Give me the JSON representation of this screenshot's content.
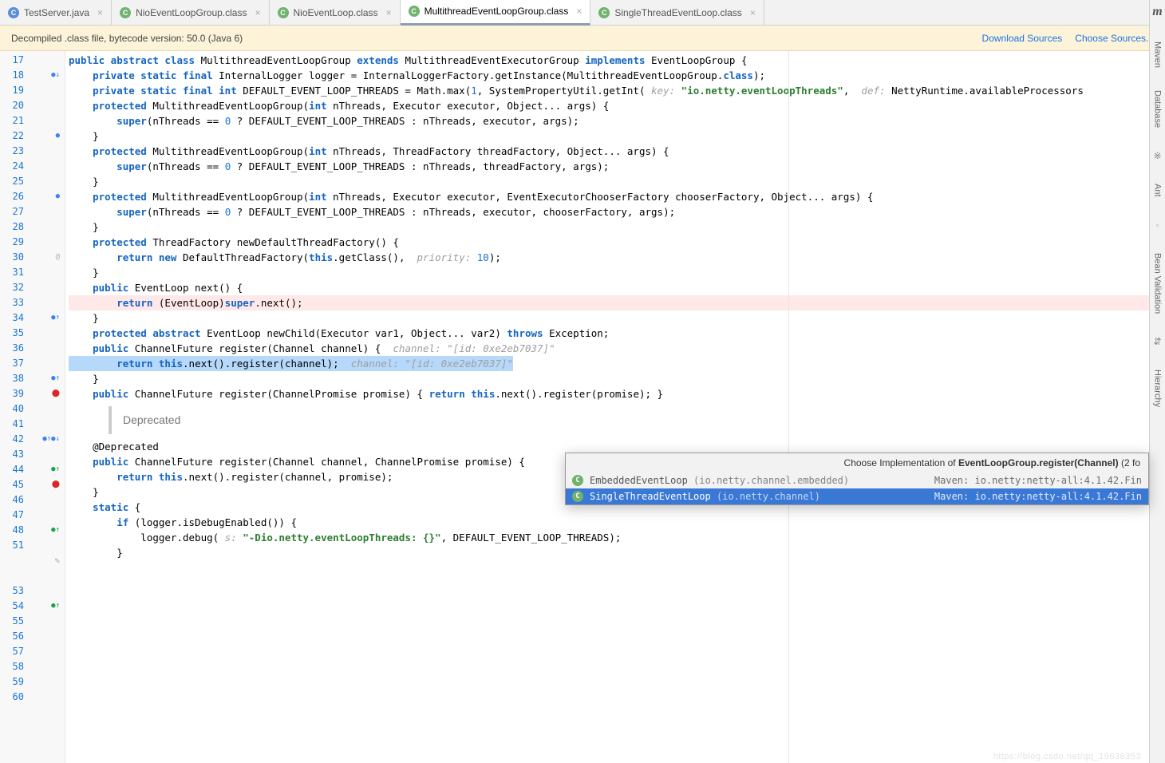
{
  "tabs": [
    {
      "name": "TestServer.java",
      "kind": "java"
    },
    {
      "name": "NioEventLoopGroup.class",
      "kind": "class"
    },
    {
      "name": "NioEventLoop.class",
      "kind": "class"
    },
    {
      "name": "MultithreadEventLoopGroup.class",
      "kind": "class",
      "active": true
    },
    {
      "name": "SingleThreadEventLoop.class",
      "kind": "class"
    }
  ],
  "banner": {
    "message": "Decompiled .class file, bytecode version: 50.0 (Java 6)",
    "link1": "Download Sources",
    "link2": "Choose Sources..."
  },
  "gutter_start": 17,
  "gutter_lines": [
    {
      "n": 17
    },
    {
      "n": 18,
      "marks": [
        "●↓"
      ],
      "cls": "m-blue"
    },
    {
      "n": 19
    },
    {
      "n": 20
    },
    {
      "n": 21
    },
    {
      "n": 22,
      "marks": [
        "●"
      ],
      "cls": "m-blue"
    },
    {
      "n": 23
    },
    {
      "n": 24
    },
    {
      "n": 25
    },
    {
      "n": 26,
      "marks": [
        "●"
      ],
      "cls": "m-blue"
    },
    {
      "n": 27
    },
    {
      "n": 28
    },
    {
      "n": 29
    },
    {
      "n": 30,
      "marks": [
        "@"
      ],
      "cls": ""
    },
    {
      "n": 31
    },
    {
      "n": 32
    },
    {
      "n": 33
    },
    {
      "n": 34,
      "marks": [
        "●↑"
      ],
      "cls": "m-blue"
    },
    {
      "n": 35
    },
    {
      "n": 36
    },
    {
      "n": 37
    },
    {
      "n": 38,
      "marks": [
        "●↑"
      ],
      "cls": "m-blue"
    },
    {
      "n": 39,
      "marks": [
        "⬤"
      ],
      "cls": "m-red"
    },
    {
      "n": 40
    },
    {
      "n": 41
    },
    {
      "n": 42,
      "marks": [
        "●↑",
        "●↓"
      ],
      "cls": "m-blue"
    },
    {
      "n": 43
    },
    {
      "n": 44,
      "marks": [
        "●↑"
      ],
      "cls": "m-green"
    },
    {
      "n": 45,
      "marks": [
        "⬤"
      ],
      "cls": "m-red"
    },
    {
      "n": 46
    },
    {
      "n": 47
    },
    {
      "n": 48,
      "marks": [
        "●↑"
      ],
      "cls": "m-green"
    },
    {
      "n": 51
    },
    {
      "n": "",
      "pencil": true
    },
    {
      "n": ""
    },
    {
      "n": 53
    },
    {
      "n": 54,
      "marks": [
        "●↑"
      ],
      "cls": "m-green"
    },
    {
      "n": 55
    },
    {
      "n": 56
    },
    {
      "n": 57
    },
    {
      "n": 58
    },
    {
      "n": 59
    },
    {
      "n": 60
    }
  ],
  "code": {
    "l18_a": "public abstract class",
    "l18_b": " MultithreadEventLoopGroup ",
    "l18_c": "extends",
    "l18_d": " MultithreadEventExecutorGroup ",
    "l18_e": "implements",
    "l18_f": " EventLoopGroup {",
    "l19_a": "    private static final",
    "l19_b": " InternalLogger logger = InternalLoggerFactory.getInstance(MultithreadEventLoopGroup.",
    "l19_c": "class",
    "l19_d": ");",
    "l20_a": "    private static final int",
    "l20_b": " DEFAULT_EVENT_LOOP_THREADS = Math.max(",
    "l20_c": "1",
    "l20_d": ", SystemPropertyUtil.getInt( ",
    "l20_key": "key: ",
    "l20_str": "\"io.netty.eventLoopThreads\"",
    "l20_e": ",  ",
    "l20_def": "def: ",
    "l20_f": "NettyRuntime.availableProcessors",
    "l22_a": "    protected",
    "l22_b": " MultithreadEventLoopGroup(",
    "l22_c": "int",
    "l22_d": " nThreads, Executor executor, Object... args) {",
    "l23_a": "        super",
    "l23_b": "(nThreads == ",
    "l23_c": "0",
    "l23_d": " ? DEFAULT_EVENT_LOOP_THREADS : nThreads, executor, args);",
    "l24": "    }",
    "l26_a": "    protected",
    "l26_b": " MultithreadEventLoopGroup(",
    "l26_c": "int",
    "l26_d": " nThreads, ThreadFactory threadFactory, Object... args) {",
    "l27_a": "        super",
    "l27_b": "(nThreads == ",
    "l27_c": "0",
    "l27_d": " ? DEFAULT_EVENT_LOOP_THREADS : nThreads, threadFactory, args);",
    "l28": "    }",
    "l30_a": "    protected",
    "l30_b": " MultithreadEventLoopGroup(",
    "l30_c": "int",
    "l30_d": " nThreads, Executor executor, EventExecutorChooserFactory chooserFactory, Object... args) {",
    "l31_a": "        super",
    "l31_b": "(nThreads == ",
    "l31_c": "0",
    "l31_d": " ? DEFAULT_EVENT_LOOP_THREADS : nThreads, executor, chooserFactory, args);",
    "l32": "    }",
    "l34_a": "    protected",
    "l34_b": " ThreadFactory newDefaultThreadFactory() {",
    "l35_a": "        return new",
    "l35_b": " DefaultThreadFactory(",
    "l35_c": "this",
    "l35_d": ".getClass(),  ",
    "l35_pri": "priority: ",
    "l35_e": "10",
    "l35_f": ");",
    "l36": "    }",
    "l38_a": "    public",
    "l38_b": " EventLoop next() {",
    "l39_a": "        return",
    "l39_b": " (EventLoop)",
    "l39_c": "super",
    "l39_d": ".next();",
    "l40": "    }",
    "l42_a": "    protected abstract",
    "l42_b": " EventLoop newChild(Executor var1, Object... var2) ",
    "l42_c": "throws",
    "l42_d": " Exception;",
    "l44_a": "    public",
    "l44_b": " ChannelFuture register(Channel channel) {  ",
    "l44_c": "channel: \"[id: 0xe2eb7037]\"",
    "l45_a": "        return this",
    "l45_b": ".next().register(channel);  ",
    "l45_c": "channel: \"[id: 0xe2eb7037]\"",
    "l46": "    }",
    "l48_a": "    public",
    "l48_b": " ChannelFuture register(ChannelPromise promise) { ",
    "l48_c": "return this",
    "l48_d": ".next().register(promise); }",
    "dep": "Deprecated",
    "l53": "    @Deprecated",
    "l54_a": "    public",
    "l54_b": " ChannelFuture register(Channel channel, ChannelPromise promise) {",
    "l55_a": "        return this",
    "l55_b": ".next().register(channel, promise);",
    "l56": "    }",
    "l58_a": "    static",
    "l58_b": " {",
    "l59_a": "        if",
    "l59_b": " (logger.isDebugEnabled()) {",
    "l60_a": "            logger.debug( ",
    "l60_s": "s: ",
    "l60_str": "\"-Dio.netty.eventLoopThreads: {}\"",
    "l60_b": ", DEFAULT_EVENT_LOOP_THREADS);",
    "l61": "        }"
  },
  "popup": {
    "title_a": "Choose Implementation of ",
    "title_b": "EventLoopGroup.register(Channel)",
    "title_c": " (2 fo",
    "rows": [
      {
        "name": "EmbeddedEventLoop",
        "pkg": "(io.netty.channel.embedded)",
        "loc": "Maven: io.netty:netty-all:4.1.42.Fin"
      },
      {
        "name": "SingleThreadEventLoop",
        "pkg": "(io.netty.channel)",
        "loc": "Maven: io.netty:netty-all:4.1.42.Fin",
        "sel": true
      }
    ]
  },
  "side": [
    "Maven",
    "Database",
    "Ant",
    "Bean Validation",
    "Hierarchy"
  ],
  "watermark": "https://blog.csdn.net/qq_19636353"
}
